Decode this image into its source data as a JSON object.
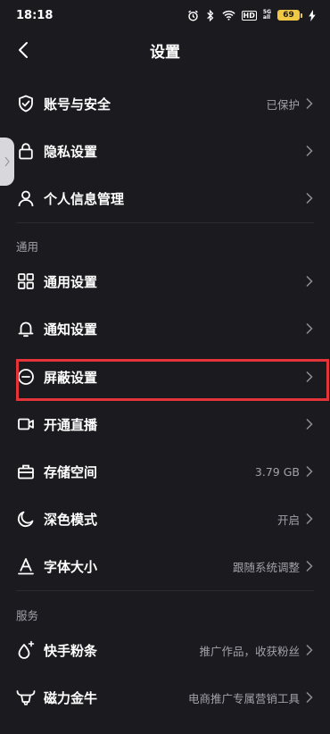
{
  "status_bar": {
    "time": "18:18",
    "network": "HD",
    "signal_tag_top": "5G",
    "signal_tag_bottom": "all",
    "battery": "69"
  },
  "header": {
    "title": "设置"
  },
  "items": {
    "account": {
      "label": "账号与安全",
      "value": "已保护",
      "icon": "shield-check-icon"
    },
    "privacy": {
      "label": "隐私设置",
      "icon": "lock-icon"
    },
    "personal": {
      "label": "个人信息管理",
      "icon": "user-icon"
    },
    "general": {
      "label": "通用设置",
      "icon": "grid-icon"
    },
    "notify": {
      "label": "通知设置",
      "icon": "bell-icon"
    },
    "block": {
      "label": "屏蔽设置",
      "icon": "minus-circle-icon"
    },
    "live": {
      "label": "开通直播",
      "icon": "video-camera-icon"
    },
    "storage": {
      "label": "存储空间",
      "value": "3.79 GB",
      "icon": "storage-box-icon"
    },
    "dark": {
      "label": "深色模式",
      "value": "开启",
      "icon": "moon-icon"
    },
    "font": {
      "label": "字体大小",
      "value": "跟随系统调整",
      "icon": "font-size-icon"
    },
    "fanstiao": {
      "label": "快手粉条",
      "value": "推广作品，收获粉丝",
      "icon": "sparkle-drop-icon"
    },
    "magnet": {
      "label": "磁力金牛",
      "value": "电商推广专属营销工具",
      "icon": "bull-icon"
    }
  },
  "sections": {
    "general": "通用",
    "services": "服务"
  },
  "colors": {
    "background": "#1b1a1f",
    "secondary_text": "#a3a2a8",
    "highlight": "#e5333a",
    "battery": "#f0c843"
  }
}
